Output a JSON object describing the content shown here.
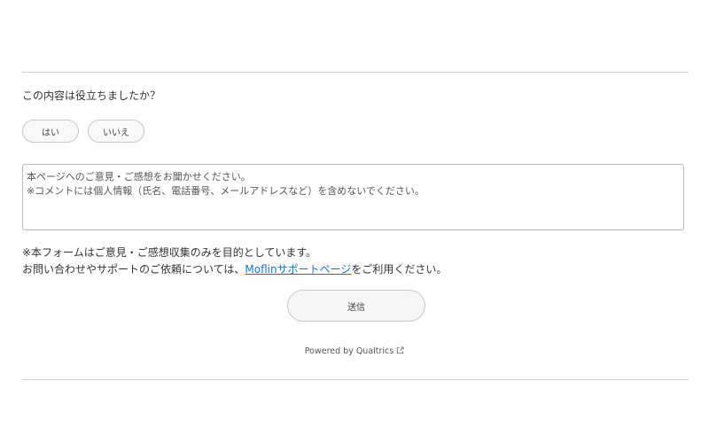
{
  "feedback": {
    "question": "この内容は役立ちましたか？",
    "yes_label": "はい",
    "no_label": "いいえ",
    "comment_placeholder": "本ページへのご意見・ご感想をお聞かせください。\n※コメントには個人情報（氏名、電話番号、メールアドレスなど）を含めないでください。",
    "note_line1": "※本フォームはご意見・ご感想収集のみを目的としています。",
    "note_line2_prefix": "お問い合わせやサポートのご依頼については、",
    "note_link": "Moflinサポートページ",
    "note_line2_suffix": "をご利用ください。",
    "submit_label": "送信",
    "powered_by": "Powered by Qualtrics",
    "powered_icon": "external-link-icon"
  }
}
